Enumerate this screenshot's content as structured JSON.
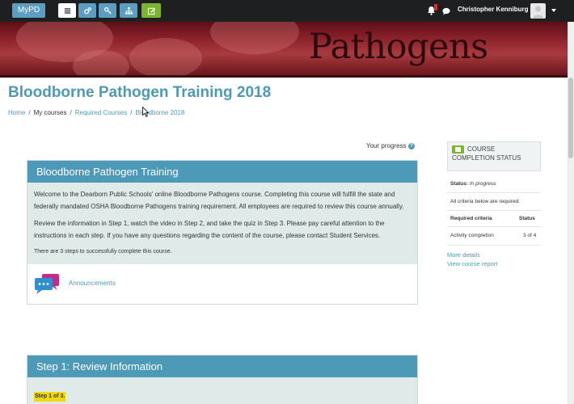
{
  "navbar": {
    "brand": "MyPD",
    "user_name": "Christopher Kenniburg",
    "colors": {
      "bar": "#1d1f21",
      "accent": "#5b9ec2",
      "edit": "#7bb52e",
      "notify": "#e2282f"
    },
    "icons": [
      "menu-icon",
      "cogs-icon",
      "key-icon",
      "sitemap-icon",
      "edit-icon",
      "bell-icon",
      "chat-icon",
      "caret-down-icon"
    ]
  },
  "banner": {
    "word": "Pathogens"
  },
  "page": {
    "title": "Bloodborne Pathogen Training 2018",
    "breadcrumb": [
      "Home",
      "My courses",
      "Required Courses",
      "Bloodborne 2018"
    ],
    "progress_label": "Your progress",
    "help_glyph": "?"
  },
  "sections": [
    {
      "title": "Bloodborne Pathogen Training",
      "paragraphs": [
        "Welcome to the Dearborn Public Schools' online Bloodborne Pathogens course.  Completing this course will fulfill the state and federally mandated OSHA Bloodborne Pathogens training requirement.  All employees are required to review this course annually.",
        "Review the information in Step 1, watch the video in Step 2, and take the quiz in Step 3.  Please pay careful attention to the instructions in each step.  If you have any questions regarding the content of the course, please contact Student Services."
      ],
      "note": "There are 3 steps to successfully complete this course.",
      "activity": "Announcements"
    },
    {
      "title": "Step 1: Review Information",
      "badge": "Step 1 of 3."
    }
  ],
  "completion_block": {
    "title": "Course Completion Status",
    "status_label": "Status:",
    "status_value": "In progress",
    "note": "All criteria below are required:",
    "col_criteria": "Required criteria",
    "col_status": "Status",
    "row_criteria": "Activity completion",
    "row_status": "3 of 4",
    "more_details": "More details",
    "view_report": "View course report"
  }
}
